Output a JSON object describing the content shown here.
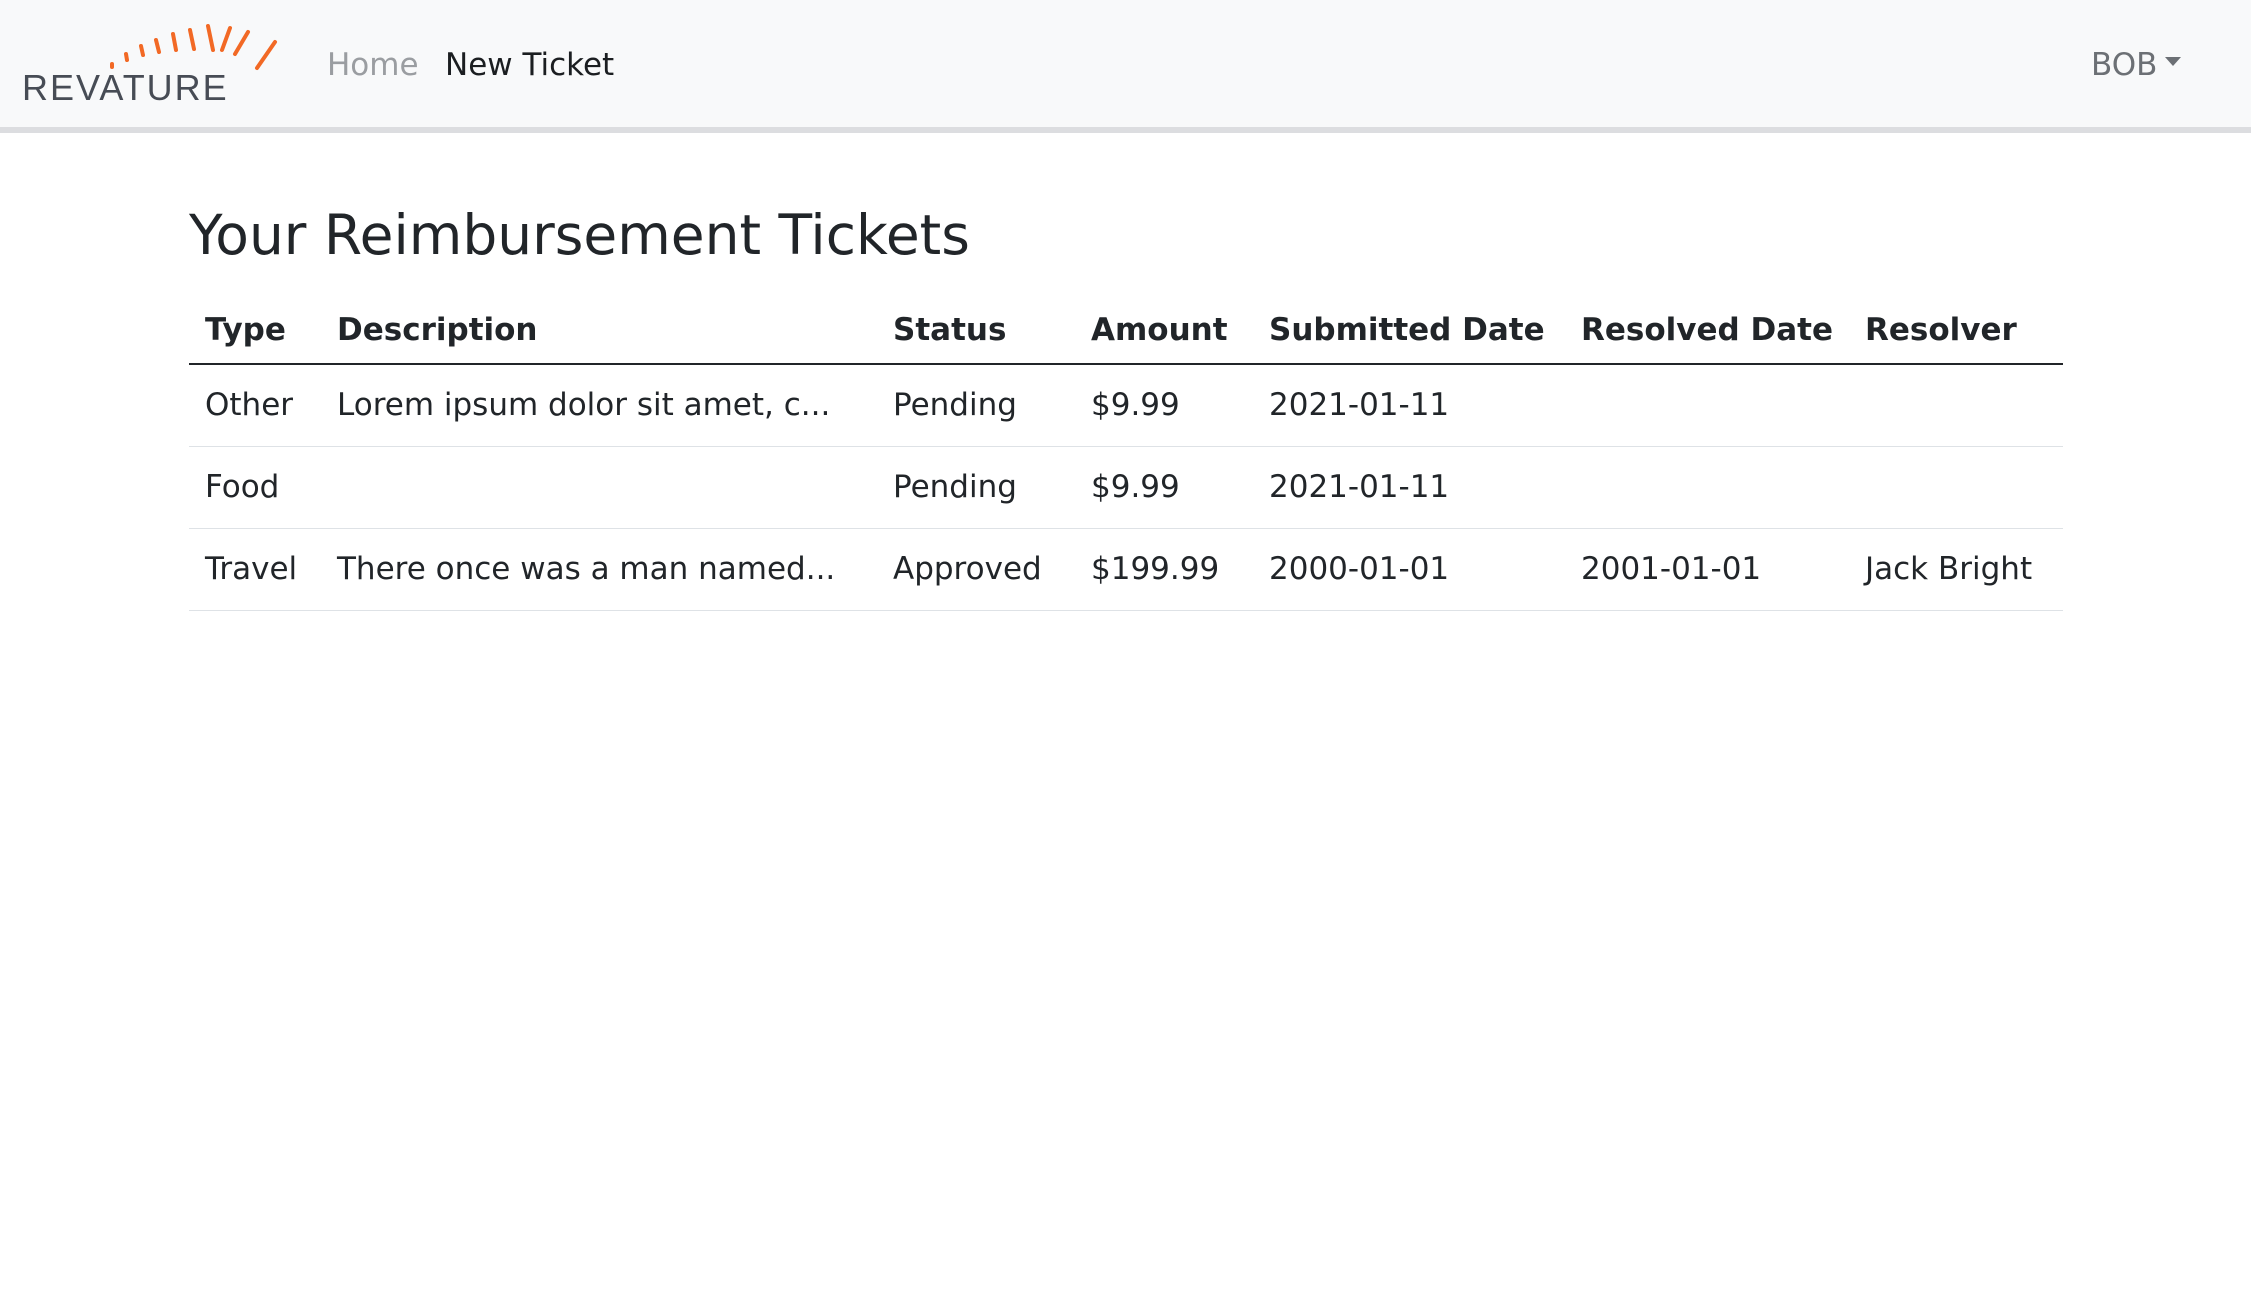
{
  "navbar": {
    "brand": "REVATURE",
    "links": [
      {
        "label": "Home"
      },
      {
        "label": "New Ticket"
      }
    ],
    "user": "BOB",
    "colors": {
      "accent": "#f26925",
      "background": "#f8f9fa"
    }
  },
  "page": {
    "title": "Your Reimbursement Tickets"
  },
  "table": {
    "headers": [
      "Type",
      "Description",
      "Status",
      "Amount",
      "Submitted Date",
      "Resolved Date",
      "Resolver"
    ],
    "rows": [
      [
        "Other",
        "Lorem ipsum dolor sit amet, c...",
        "Pending",
        "$9.99",
        "2021-01-11",
        "",
        ""
      ],
      [
        "Food",
        "",
        "Pending",
        "$9.99",
        "2021-01-11",
        "",
        ""
      ],
      [
        "Travel",
        "There once was a man named...",
        "Approved",
        "$199.99",
        "2000-01-01",
        "2001-01-01",
        "Jack Bright"
      ]
    ]
  }
}
